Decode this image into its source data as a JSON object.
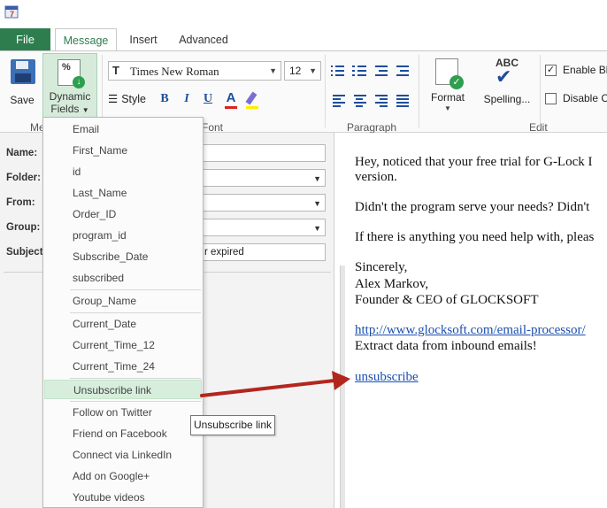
{
  "tabs": {
    "file": "File",
    "message": "Message",
    "insert": "Insert",
    "advanced": "Advanced"
  },
  "ribbon": {
    "save": "Save",
    "dynamic_fields_line1": "Dynamic",
    "dynamic_fields_line2": "Fields",
    "font_name": "Times New Roman",
    "font_size": "12",
    "style": "Style",
    "bold": "B",
    "italic": "I",
    "underline": "U",
    "font_color_glyph": "A",
    "format": "Format",
    "spelling": "Spelling...",
    "spelling_abc": "ABC",
    "enable_label": "Enable Bl",
    "disable_label": "Disable C",
    "enable_checked": "✓",
    "groups": {
      "message": "Me",
      "font": "Font",
      "paragraph": "Paragraph",
      "edit": "Edit"
    }
  },
  "form": {
    "name_label": "Name:",
    "folder_label": "Folder:",
    "from_label": "From:",
    "group_label": "Group:",
    "subject_label": "Subject",
    "subject_value": "r expired"
  },
  "dropdown_items": [
    "Email",
    "First_Name",
    "id",
    "Last_Name",
    "Order_ID",
    "program_id",
    "Subscribe_Date",
    "subscribed",
    "Group_Name",
    "Current_Date",
    "Current_Time_12",
    "Current_Time_24",
    "Unsubscribe link",
    "Follow on Twitter",
    "Friend on Facebook",
    "Connect via LinkedIn",
    "Add on Google+",
    "Youtube videos"
  ],
  "tooltip": "Unsubscribe link",
  "editor": {
    "line1": "Hey, noticed that your free trial for G-Lock I",
    "line2": "version.",
    "line3": "Didn't the program serve your needs? Didn't",
    "line4": "If there is anything you need help with, pleas",
    "line5": "Sincerely,",
    "line6": "Alex Markov,",
    "line7": "Founder & CEO of GLOCKSOFT",
    "link_url": "http://www.glocksoft.com/email-processor/",
    "line9": "Extract data from inbound emails!",
    "unsubscribe": "unsubscribe"
  },
  "colors": {
    "accent_green": "#2e7d4f",
    "hover_green": "#d6eedb",
    "arrow_red": "#b3261e",
    "link_blue": "#1a4fb0"
  },
  "icons": [
    "app-icon",
    "save-icon",
    "dynamic-fields-icon",
    "font-icon",
    "style-icon",
    "bold-icon",
    "italic-icon",
    "underline-icon",
    "font-color-icon",
    "highlight-icon",
    "bullets-icon",
    "numbering-icon",
    "decrease-indent-icon",
    "increase-indent-icon",
    "align-left-icon",
    "align-center-icon",
    "align-right-icon",
    "justify-icon",
    "format-icon",
    "spelling-icon",
    "chevron-down-icon",
    "arrow-annotation"
  ]
}
